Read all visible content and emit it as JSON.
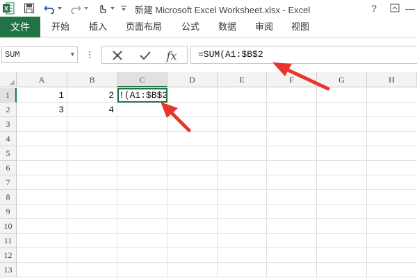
{
  "titlebar": {
    "title": "新建 Microsoft Excel Worksheet.xlsx - Excel",
    "help": "?",
    "restore": "̅",
    "minimize": "—",
    "app_icon": "excel-icon"
  },
  "ribbon": {
    "file_tab": "文件",
    "tabs": [
      "开始",
      "插入",
      "页面布局",
      "公式",
      "数据",
      "审阅",
      "视图"
    ]
  },
  "formula_bar": {
    "name_box": "SUM",
    "formula": "=SUM(A1:$B$2"
  },
  "sheet": {
    "columns": [
      "A",
      "B",
      "C",
      "D",
      "E",
      "F",
      "G",
      "H"
    ],
    "rows": [
      "1",
      "2",
      "3",
      "4",
      "5",
      "6",
      "7",
      "8",
      "9",
      "10",
      "11",
      "12",
      "13"
    ],
    "active_column": "C",
    "active_row": "1",
    "cells": {
      "A1": "1",
      "B1": "2",
      "C1": "!(A1:$B$2",
      "A2": "3",
      "B2": "4"
    }
  },
  "colors": {
    "accent": "#217346",
    "arrow": "#e8352b"
  }
}
